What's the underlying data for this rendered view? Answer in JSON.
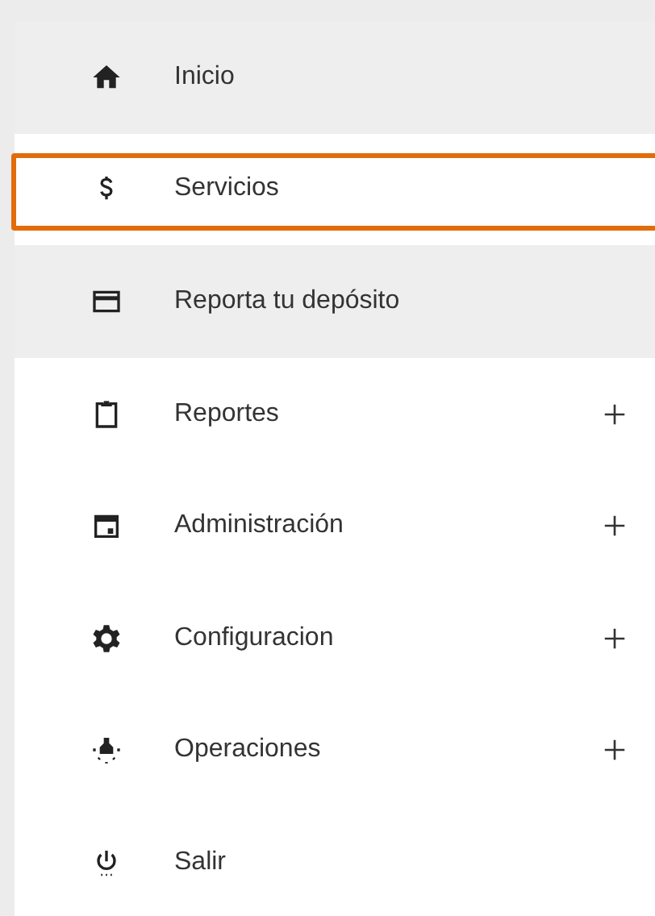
{
  "menu": {
    "items": [
      {
        "label": "Inicio",
        "shaded": true,
        "selected": false,
        "expandable": false
      },
      {
        "label": "Servicios",
        "shaded": false,
        "selected": true,
        "expandable": false
      },
      {
        "label": "Reporta tu depósito",
        "shaded": true,
        "selected": false,
        "expandable": false
      },
      {
        "label": "Reportes",
        "shaded": false,
        "selected": false,
        "expandable": true
      },
      {
        "label": "Administración",
        "shaded": false,
        "selected": false,
        "expandable": true
      },
      {
        "label": "Configuracion",
        "shaded": false,
        "selected": false,
        "expandable": true
      },
      {
        "label": "Operaciones",
        "shaded": false,
        "selected": false,
        "expandable": true
      },
      {
        "label": "Salir",
        "shaded": false,
        "selected": false,
        "expandable": false
      }
    ]
  }
}
